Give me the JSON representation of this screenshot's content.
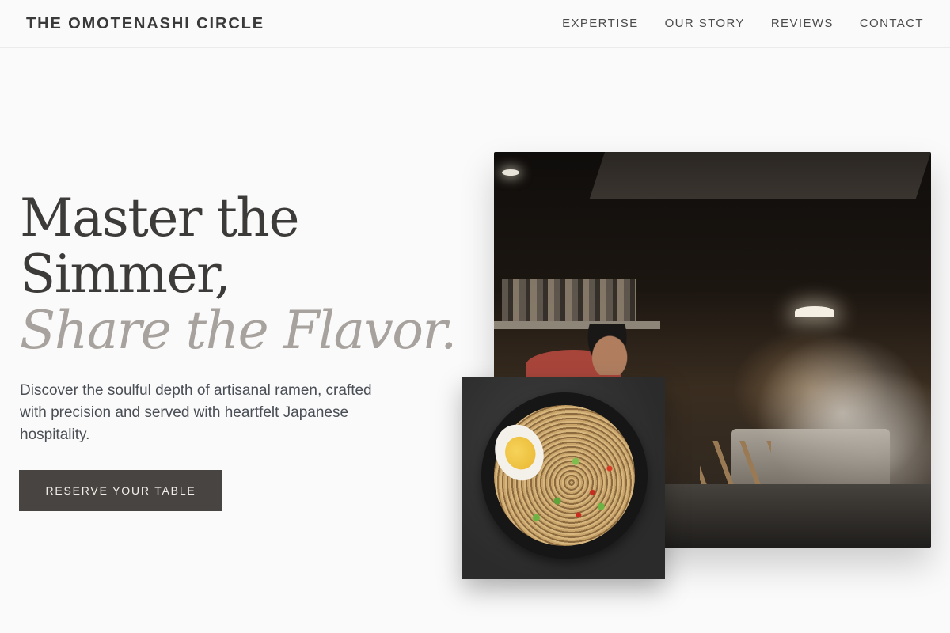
{
  "header": {
    "brand": "THE OMOTENASHI CIRCLE",
    "nav": [
      {
        "label": "EXPERTISE"
      },
      {
        "label": "OUR STORY"
      },
      {
        "label": "REVIEWS"
      },
      {
        "label": "CONTACT"
      }
    ]
  },
  "hero": {
    "headline_line1": "Master the",
    "headline_line2": "Simmer,",
    "headline_accent": "Share the Flavor.",
    "lead": "Discover the soulful depth of artisanal ramen, crafted with precision and served with heartfelt Japanese hospitality.",
    "cta_label": "RESERVE YOUR TABLE"
  },
  "images": {
    "kitchen": "ramen-shop-kitchen-photo",
    "ramen": "ramen-bowl-photo"
  },
  "colors": {
    "background": "#fafafa",
    "text": "#3d3b39",
    "accent_text": "#a7a29d",
    "button": "#484441",
    "button_text": "#f2efeb"
  }
}
